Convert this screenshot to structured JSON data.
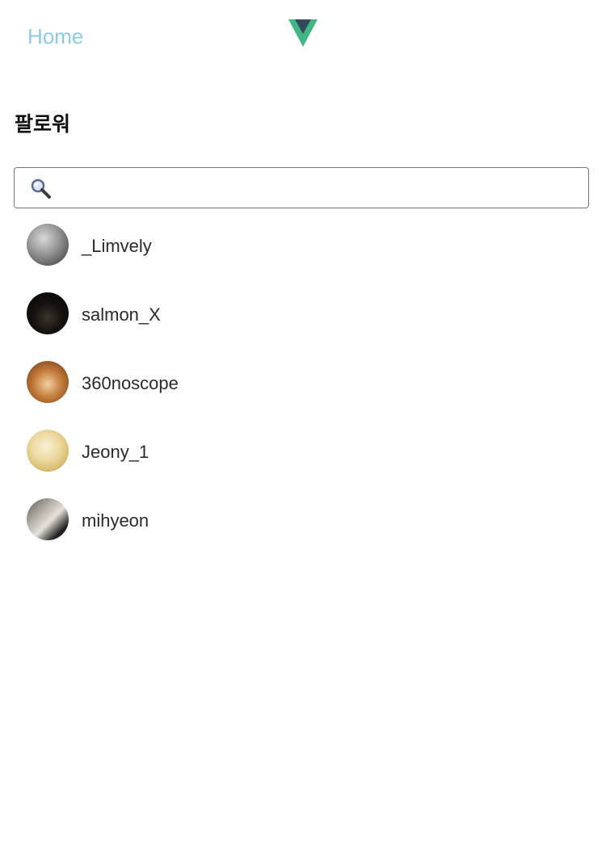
{
  "header": {
    "home_label": "Home",
    "logo": "vue-logo-icon",
    "logo_colors": {
      "outer": "#41b883",
      "inner": "#35495e"
    }
  },
  "page": {
    "title": "팔로워"
  },
  "search": {
    "icon": "search-icon",
    "value": "",
    "placeholder": ""
  },
  "followers": [
    {
      "username": "_Limvely"
    },
    {
      "username": "salmon_X"
    },
    {
      "username": "360noscope"
    },
    {
      "username": "Jeony_1"
    },
    {
      "username": "mihyeon"
    }
  ],
  "colors": {
    "home_link": "#8ecbe8",
    "text": "#2a2a2a",
    "search_border": "#777777"
  }
}
